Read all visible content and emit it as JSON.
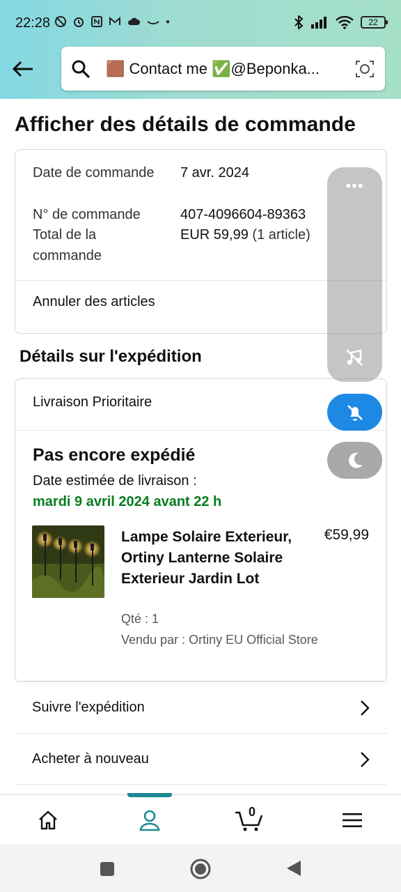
{
  "status_bar": {
    "time": "22:28",
    "battery": "22"
  },
  "search": {
    "query": "🟫 Contact me ✅@Beponka..."
  },
  "page": {
    "title": "Afficher des détails de commande"
  },
  "order": {
    "date_label": "Date de commande",
    "date_value": "7 avr. 2024",
    "number_label": "N° de commande",
    "number_value": "407-4096604-89363",
    "total_label": "Total de la commande",
    "total_value": "EUR 59,99",
    "total_items": "(1 article)",
    "cancel_label": "Annuler des articles"
  },
  "shipping": {
    "section_title": "Détails sur l'expédition",
    "method": "Livraison Prioritaire",
    "status": "Pas encore expédié",
    "estimate_label": "Date estimée de livraison :",
    "estimate_date": "mardi 9 avril 2024 avant 22 h",
    "product": {
      "name": "Lampe Solaire Exterieur, Ortiny Lanterne Solaire Exterieur Jardin Lot",
      "price": "€59,99",
      "qty": "Qté : 1",
      "seller": "Vendu par : Ortiny EU Official Store"
    }
  },
  "actions": {
    "track": "Suivre l'expédition",
    "buy_again": "Acheter à nouveau"
  },
  "floating": {
    "dots": "•••"
  },
  "bottom_nav": {
    "cart_count": "0",
    "active": "account"
  },
  "colors": {
    "accent_teal": "#1a8a94",
    "delivery_green": "#067d1f",
    "bell_blue": "#1e88e5"
  }
}
